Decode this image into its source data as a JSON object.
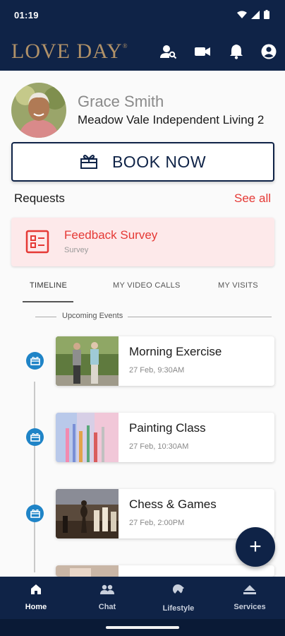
{
  "status_bar": {
    "time": "01:19"
  },
  "app_bar": {
    "logo": "LOVE DAY",
    "logo_mark": "®"
  },
  "profile": {
    "name": "Grace Smith",
    "residence": "Meadow Vale Independent Living 2"
  },
  "book_button": {
    "label": "BOOK NOW"
  },
  "requests": {
    "title": "Requests",
    "see_all": "See all",
    "card": {
      "title": "Feedback Survey",
      "subtitle": "Survey"
    }
  },
  "tabs": [
    {
      "label": "TIMELINE",
      "active": true
    },
    {
      "label": "MY VIDEO CALLS",
      "active": false
    },
    {
      "label": "MY VISITS",
      "active": false
    }
  ],
  "timeline": {
    "section_label": "Upcoming Events",
    "events": [
      {
        "title": "Morning Exercise",
        "time": "27 Feb, 9:30AM"
      },
      {
        "title": "Painting Class",
        "time": "27 Feb, 10:30AM"
      },
      {
        "title": "Chess & Games",
        "time": "27 Feb, 2:00PM"
      }
    ]
  },
  "fab": {
    "label": "+"
  },
  "bottom_nav": [
    {
      "label": "Home",
      "icon": "home-icon",
      "active": true
    },
    {
      "label": "Chat",
      "icon": "people-icon",
      "active": false
    },
    {
      "label": "Lifestyle",
      "icon": "lifestyle-icon",
      "active": false
    },
    {
      "label": "Services",
      "icon": "services-icon",
      "active": false
    }
  ],
  "colors": {
    "navy": "#0f2347",
    "gold": "#b09168",
    "red": "#e53935",
    "request_bg": "#fde9ea",
    "timeline_dot": "#1f84c7"
  }
}
